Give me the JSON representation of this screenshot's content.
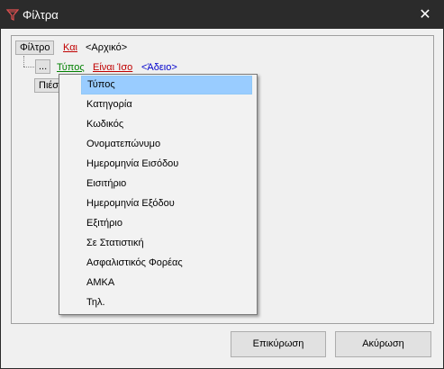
{
  "window": {
    "title": "Φίλτρα",
    "close_glyph": "✕",
    "icon": "filter-app-icon"
  },
  "filter_tree": {
    "root_label": "Φίλτρο",
    "root_operator": "Και",
    "root_operator_color": "#c00000",
    "root_group": "<Αρχικό>",
    "expand_label": "...",
    "condition_field": "Τύπος",
    "condition_field_color": "#008000",
    "condition_operator": "Είναι Ίσο",
    "condition_operator_color": "#c00000",
    "condition_value": "<Άδειο>",
    "condition_value_color": "#0000cc",
    "add_button_label": "Πιέσ"
  },
  "field_dropdown": {
    "selected_index": 0,
    "items": [
      "Τύπος",
      "Κατηγορία",
      "Κωδικός",
      "Ονοματεπώνυμο",
      "Ημερομηνία Εισόδου",
      "Εισιτήριο",
      "Ημερομηνία Εξόδου",
      "Εξιτήριο",
      "Σε Στατιστική",
      "Ασφαλιστικός Φορέας",
      "ΑΜΚΑ",
      "Τηλ."
    ]
  },
  "footer": {
    "confirm_label": "Επικύρωση",
    "cancel_label": "Ακύρωση"
  }
}
